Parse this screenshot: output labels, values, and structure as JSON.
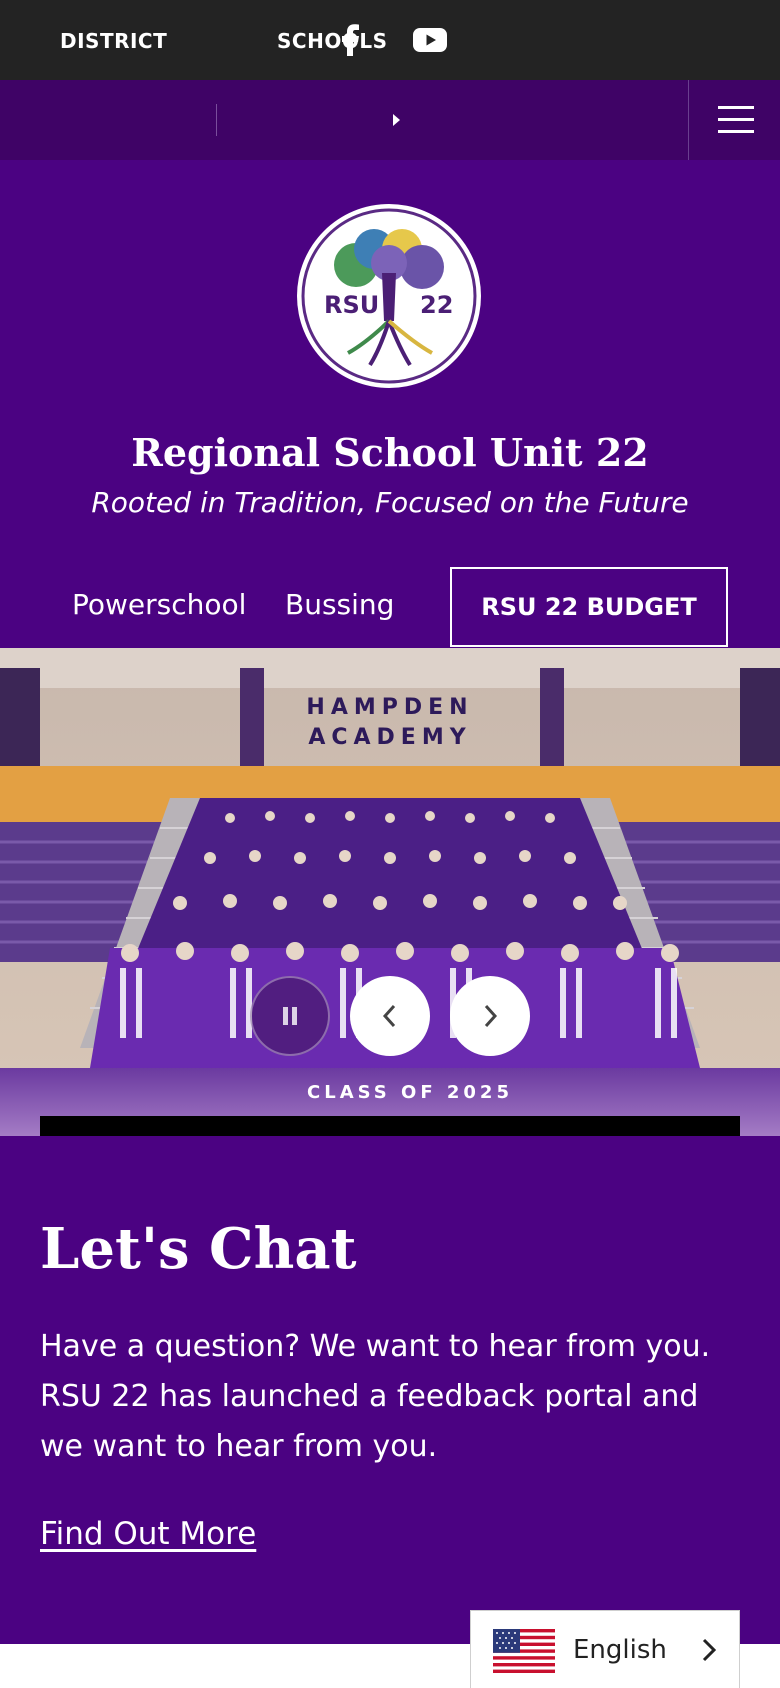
{
  "social": {
    "facebook_icon": "facebook-icon",
    "youtube_icon": "youtube-icon"
  },
  "nav": {
    "district": "DISTRICT",
    "schools": "SCHOOLS",
    "menu_icon": "hamburger-menu-icon"
  },
  "site": {
    "logo_text_left": "RSU",
    "logo_text_right": "22",
    "name": "Regional School Unit 22",
    "tagline": "Rooted in Tradition, Focused on the Future"
  },
  "quick_links": {
    "powerschool": "Powerschool",
    "bussing": "Bussing",
    "budget": "RSU 22 BUDGET"
  },
  "slideshow": {
    "sign_line1": "HAMPDEN",
    "sign_line2": "ACADEMY",
    "caption": "CLASS OF 2025",
    "pause_icon": "pause-icon",
    "prev_icon": "chevron-left-icon",
    "next_icon": "chevron-right-icon"
  },
  "chat": {
    "title": "Let's Chat",
    "body": "Have a question? We want to hear from you. RSU 22 has launched a feedback portal and we want to hear from you.",
    "link": "Find Out More"
  },
  "language": {
    "label": "English",
    "flag_icon": "us-flag-icon",
    "chevron_icon": "chevron-right-icon"
  },
  "colors": {
    "topbar": "#232323",
    "navbar": "#3f0366",
    "brand_purple": "#4b0282"
  }
}
